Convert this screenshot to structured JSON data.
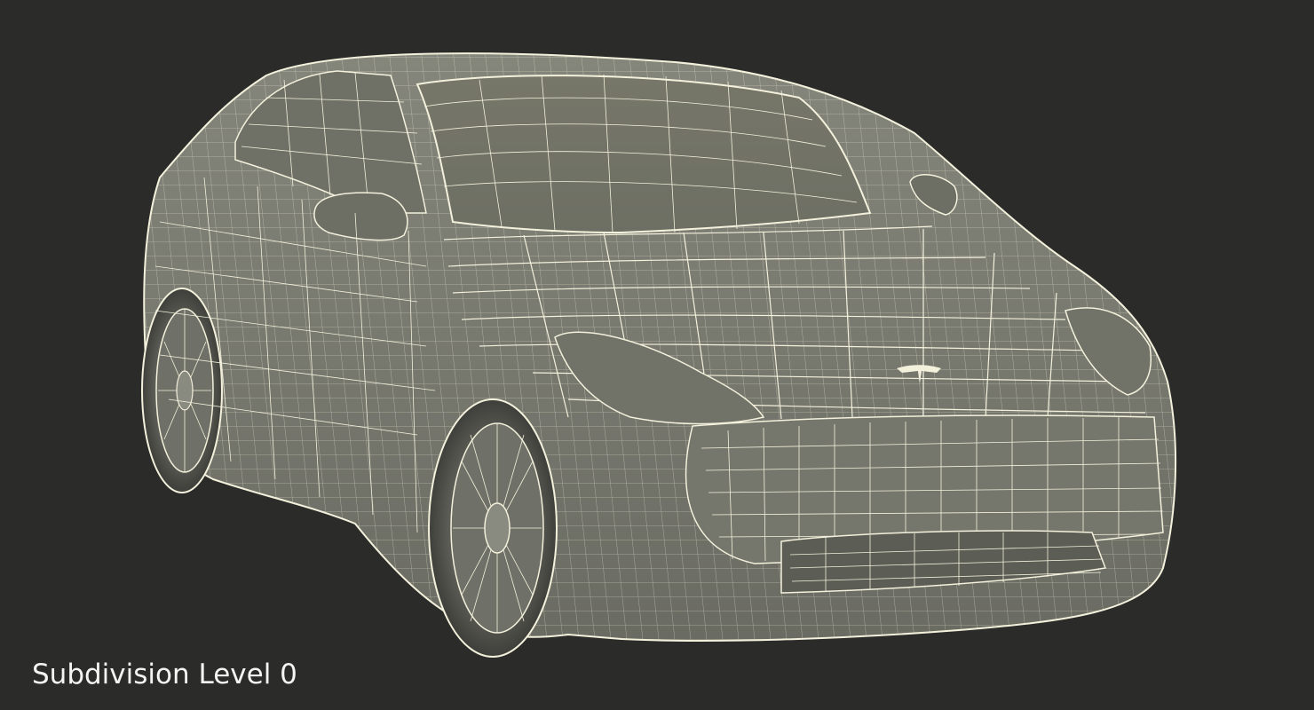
{
  "caption": "Subdivision Level 0",
  "colors": {
    "background": "#2b2b2a",
    "body": "#7c7d72",
    "body_shadow": "#5f6057",
    "wireframe": "#f3f0dc",
    "caption_text": "#f4f4f0"
  },
  "subject": "car-wireframe"
}
